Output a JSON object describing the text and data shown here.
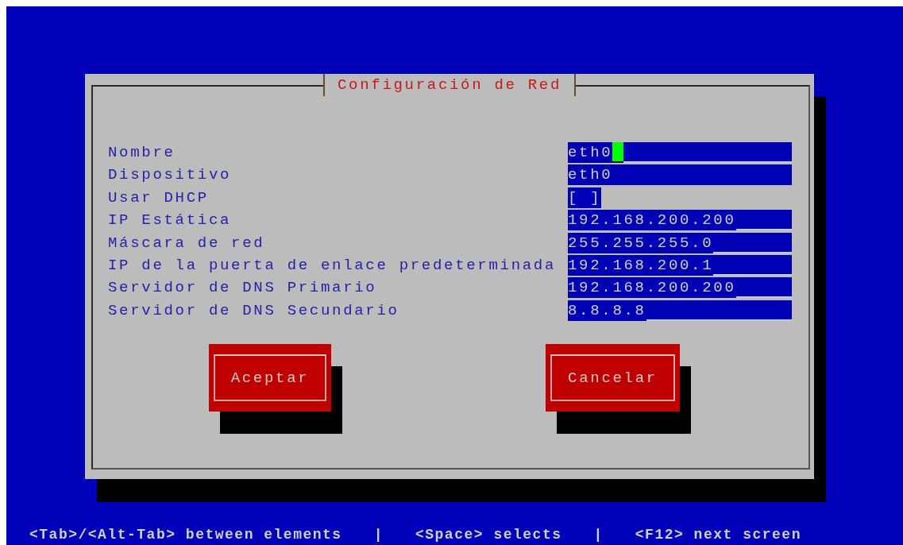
{
  "dialog": {
    "title": "Configuración de Red",
    "fields": [
      {
        "label": "Nombre",
        "kind": "entry",
        "value": "eth0",
        "focused": true
      },
      {
        "label": "Dispositivo",
        "kind": "readonly",
        "value": "eth0",
        "focused": false
      },
      {
        "label": "Usar DHCP",
        "kind": "checkbox",
        "value": "[ ]",
        "checked": false,
        "focused": false
      },
      {
        "label": "IP Estática",
        "kind": "entry",
        "value": "192.168.200.200",
        "focused": false
      },
      {
        "label": "Máscara de red",
        "kind": "entry",
        "value": "255.255.255.0",
        "focused": false
      },
      {
        "label": "IP de la puerta de enlace predeterminada",
        "kind": "entry",
        "value": "192.168.200.1",
        "focused": false
      },
      {
        "label": "Servidor de DNS Primario",
        "kind": "entry",
        "value": "192.168.200.200",
        "focused": false
      },
      {
        "label": "Servidor de DNS Secundario",
        "kind": "entry",
        "value": "8.8.8.8",
        "focused": false
      }
    ],
    "buttons": [
      "Aceptar",
      "Cancelar"
    ]
  },
  "help_bar": [
    "<Tab>/<Alt-Tab> between elements",
    "|",
    "<Space> selects",
    "|",
    "<F12> next screen"
  ]
}
